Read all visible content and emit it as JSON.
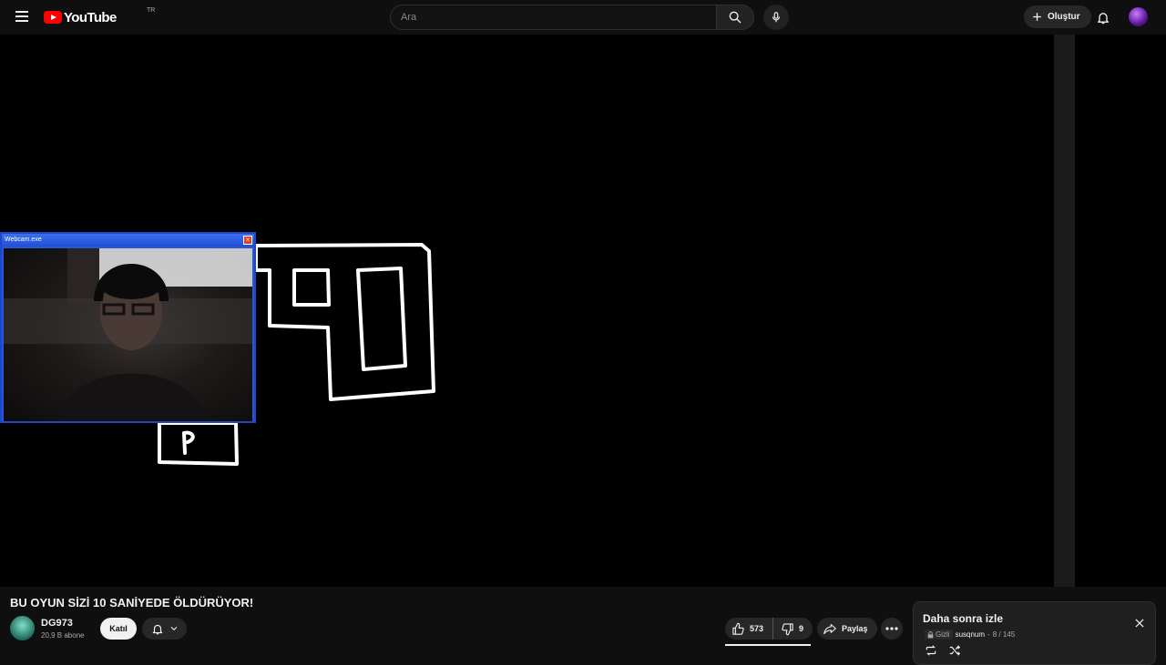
{
  "masthead": {
    "logo_text": "YouTube",
    "country_code": "TR",
    "search_placeholder": "Ara",
    "create_label": "Oluştur"
  },
  "player": {
    "webcam_window_title": "Webcam.exe"
  },
  "video": {
    "title": "BU OYUN SİZİ 10 SANİYEDE ÖLDÜRÜYOR!",
    "channel_name": "DG973",
    "channel_subs": "20,9 B abone",
    "join_label": "Katıl",
    "like_count": "573",
    "dislike_count": "9",
    "share_label": "Paylaş"
  },
  "playlist": {
    "title": "Daha sonra izle",
    "privacy": "Gizli",
    "author": "susqnum",
    "separator": "-",
    "position": "8 / 145"
  },
  "icons": [
    "menu-icon",
    "search-icon",
    "mic-icon",
    "plus-icon",
    "bell-icon",
    "thumb-up-icon",
    "thumb-down-icon",
    "share-icon",
    "more-icon",
    "close-icon",
    "lock-icon",
    "loop-icon",
    "shuffle-icon",
    "chevron-down-icon"
  ],
  "colors": {
    "background": "#0f0f0f",
    "brand_red": "#ff0000",
    "webcam_frame": "#2a55d8"
  }
}
